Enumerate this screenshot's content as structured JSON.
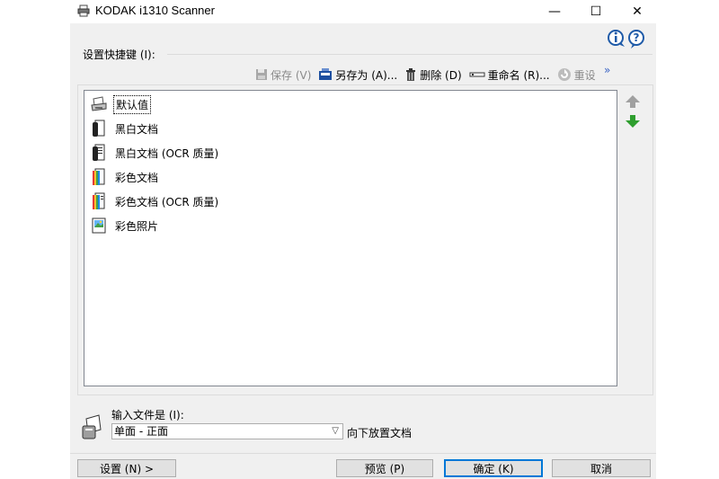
{
  "window": {
    "title": "KODAK i1310 Scanner",
    "controls": {
      "minimize": "—",
      "maximize": "☐",
      "close": "✕"
    }
  },
  "group": {
    "label": "设置快捷键 (I):"
  },
  "toolbar": {
    "save": "保存 (V)",
    "save_as": "另存为 (A)...",
    "delete": "删除 (D)",
    "rename": "重命名 (R)...",
    "reset": "重设",
    "more": "»"
  },
  "shortcuts": [
    {
      "label": "默认值",
      "icon": "scanner-icon",
      "selected": true
    },
    {
      "label": "黑白文档",
      "icon": "bw-document-icon",
      "selected": false
    },
    {
      "label": "黑白文档 (OCR 质量)",
      "icon": "bw-document-ocr-icon",
      "selected": false
    },
    {
      "label": "彩色文档",
      "icon": "color-document-icon",
      "selected": false
    },
    {
      "label": "彩色文档 (OCR 质量)",
      "icon": "color-document-ocr-icon",
      "selected": false
    },
    {
      "label": "彩色照片",
      "icon": "color-photo-icon",
      "selected": false
    }
  ],
  "input": {
    "label": "输入文件是 (I):",
    "selected": "单面 - 正面",
    "hint": "向下放置文档"
  },
  "buttons": {
    "settings": "设置 (N) >",
    "preview": "预览 (P)",
    "ok": "确定 (K)",
    "cancel": "取消"
  },
  "colors": {
    "accent": "#0078d7",
    "arrow_up": "#a0a0a0",
    "arrow_down": "#2e9e2e",
    "help": "#1e5aa8"
  }
}
